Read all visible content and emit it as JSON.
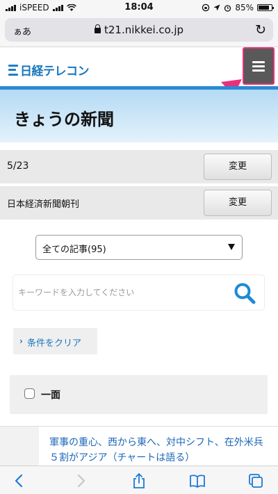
{
  "status_bar": {
    "carrier": "iSPEED",
    "time": "18:04",
    "battery_percent": "85%",
    "battery_level": 0.85
  },
  "browser": {
    "aa_label": "ぁあ",
    "url": "t21.nikkei.co.jp"
  },
  "header": {
    "logo_text": "日経テレコン",
    "menu_icon": "hamburger-icon",
    "accent_color": "#e8317a",
    "brand_color": "#1a77bf"
  },
  "page": {
    "title": "きょうの新聞"
  },
  "date_row": {
    "date": "5/23",
    "change_label": "変更"
  },
  "paper_row": {
    "paper": "日本経済新聞朝刊",
    "change_label": "変更"
  },
  "filter": {
    "selected": "全ての記事(95)"
  },
  "search": {
    "placeholder": "キーワードを入力してください",
    "icon": "search-icon"
  },
  "clear": {
    "label": "条件をクリア"
  },
  "section": {
    "label": "一面",
    "checked": false
  },
  "articles": [
    {
      "title": "軍事の重心、西から東へ、対中シフト、在外米兵５割がアジア（チャートは語る）"
    }
  ]
}
